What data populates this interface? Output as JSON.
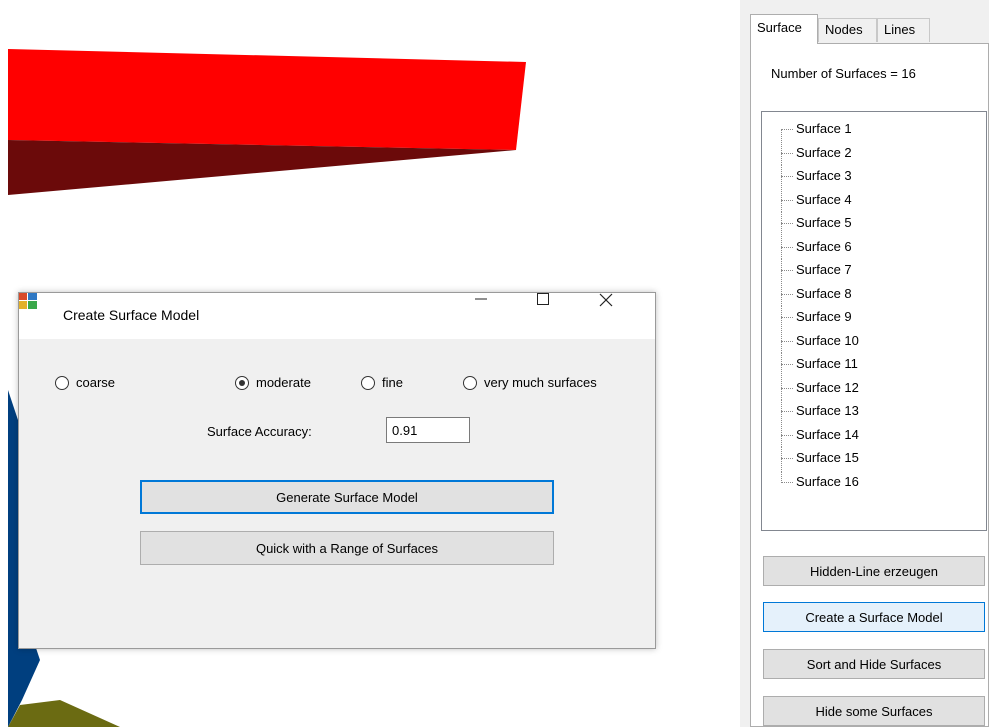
{
  "dialog": {
    "title": "Create Surface Model",
    "window_controls": {
      "minimize_icon": "minimize-icon",
      "maximize_icon": "maximize-icon",
      "close_icon": "close-icon"
    },
    "radios": [
      {
        "label": "coarse",
        "checked": false
      },
      {
        "label": "moderate",
        "checked": true
      },
      {
        "label": "fine",
        "checked": false
      },
      {
        "label": "very much surfaces",
        "checked": false
      }
    ],
    "accuracy_label": "Surface Accuracy:",
    "accuracy_value": "0.91",
    "generate_button": "Generate Surface Model",
    "quick_button": "Quick with a Range of Surfaces"
  },
  "panel": {
    "tabs": [
      {
        "label": "Surface",
        "active": true
      },
      {
        "label": "Nodes",
        "active": false
      },
      {
        "label": "Lines",
        "active": false
      }
    ],
    "count_text": "Number of Surfaces =  16",
    "tree_items": [
      "Surface  1",
      "Surface  2",
      "Surface  3",
      "Surface  4",
      "Surface  5",
      "Surface  6",
      "Surface  7",
      "Surface  8",
      "Surface  9",
      "Surface  10",
      "Surface  11",
      "Surface  12",
      "Surface  13",
      "Surface  14",
      "Surface  15",
      "Surface  16"
    ],
    "buttons": [
      "Hidden-Line erzeugen",
      "Create a Surface Model",
      "Sort and Hide Surfaces",
      "Hide some Surfaces"
    ]
  },
  "colors": {
    "accent": "#0078d7",
    "surface_red": "#ff0000",
    "surface_dark_red": "#6b0a0a",
    "surface_blue": "#003f7f",
    "surface_olive": "#6b6b12"
  }
}
